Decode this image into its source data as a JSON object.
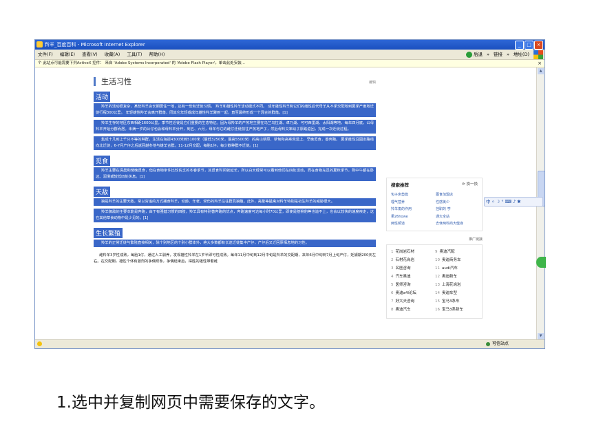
{
  "window": {
    "title": "羚羊_百度百科 - Microsoft Internet Explorer",
    "controls": [
      "_",
      "□",
      "×"
    ]
  },
  "menubar": {
    "items": [
      "文件(F)",
      "编辑(E)",
      "查看(V)",
      "收藏(A)",
      "工具(T)",
      "帮助(H)"
    ],
    "back": "后退",
    "arrows": "»",
    "link": "链接",
    "address": "地址(D)"
  },
  "infobar": {
    "text": "个 此站点可能需要下列ActiveX 控件： 来自 'Adobe Systems Incorporated' 的 'Adobe Flash Player'。单击此处安装...",
    "close": "×"
  },
  "article": {
    "section_title": "生活习性",
    "edit_label": "编辑",
    "activity": {
      "heading": "活动",
      "paragraphs": [
        "羚羊的活动很复杂，某些羚羊会长期居住一地，还有一些有迁徙习惯。 羚羊和雄性羚羊活动模式不同。 成年雄性羚羊和它们的雌性后代母羊从不季交配地到夏季产崽地迁徙行程300公里。 年轻雄性羚羊会离开群落，同其它年轻或成年雄性羚羊聚到一起，直至最终形成一个混合的群落。[1]",
        "羚羊生存的地区东西相距1600公里，季节性迁徙是它们重要的生态特征。因为母羚羊的产羔地主要在乌兰乌拉湖、卓乃湖、可可西里湖、太阳湖等地，每年四月底，公母羚羊开始分群而居。未满一岁的公仔也会和母羚羊分开，到五、六月，母羊与它的雌仔迁徙前往产羔地产子，然后母羚又率幼子原路返回，完成一次迁徙过程。",
        "集成十几到上千只不等的种群。生活在海拔4300米到5100米（最低3250米，最高5500米）的高山草原、草甸和高寒荒漠上，早晚觅食，善奔跑。 夏季雌性沿固定路线向北迁徙，6-7月产仔之后返回越冬地与雄羊合群。11-12月交配，每胎1仔。每少数种群不迁徙。[1]"
      ]
    },
    "food": {
      "heading": "觅食",
      "paragraphs": [
        "羚羊主要在清晨和傍晚觅食，但在食物条件比较贫乏的冬春季节，其觅食时间就延长，所以白天经常可以看到他们在四处活动，而在食物充足的夏秋季节，则中午都在卧边、润滑或较低凹处休息。[1]"
      ]
    },
    "enemy": {
      "heading": "天敌",
      "paragraphs": [
        "狼是羚羊的主要天敌，常以穷追的方式捕食羚羊，幼龄、年老、受伤的羚羊往往群具狼腹。此外，亮繁等猛禽对羚羊特别是初生羚羊的威胁很大。",
        "羚羊御敌的主要本能是奔跑，由于有强健习惯的四肢，羚羊具有特别善奔跑的优点，奔跑速度可达每小时70公里，即使是猞猁豹等也追不上，也会以较快的速度疾走，这在其他草食动物中是少见的。[1]"
      ]
    },
    "breed": {
      "heading": "生长繁殖",
      "paragraphs": [
        "羚羊的正常迁徙与繁殖直接相关，除个别地区的个别小群体外，绝大多数都有长途迁徙集中产仔，产仔后又迁回原栖息地的习性。"
      ],
      "plain": "雌羚羊3岁性成熟，每胎1仔，通过人工驯养，发现雄性羚羊在1岁半即可性成熟。每年11月中旬到12月中旬是羚羊的交配期，来年6月中旬到7月上旬产仔，妊娠期200天左右。在交配期，雄性个体有激烈的争偶现象，争偶结束后，得胜的雄性带着雌"
    }
  },
  "sidebar": {
    "search_title": "搜索推荐",
    "swap_label": "换一换",
    "links": [
      "包子床垫篇",
      "图食加盟店",
      "理气营养",
      "性感美少",
      "羚羊角的作用",
      "挂职的 亭",
      "果26howe",
      "通大全站",
      "两性频道",
      "去休两科商大健身"
    ],
    "ad_label": "推广链接",
    "rank": [
      {
        "n": "1",
        "t": "花岗岩石材"
      },
      {
        "n": "9",
        "t": "奥迪汽配"
      },
      {
        "n": "2",
        "t": "石材花岗岩"
      },
      {
        "n": "10",
        "t": "奥迪商务车"
      },
      {
        "n": "3",
        "t": "名医咨询"
      },
      {
        "n": "11",
        "t": "audi汽车"
      },
      {
        "n": "4",
        "t": "汽车奥迪"
      },
      {
        "n": "12",
        "t": "奥迪新车"
      },
      {
        "n": "5",
        "t": "医师咨询"
      },
      {
        "n": "13",
        "t": "上海花岗岩"
      },
      {
        "n": "6",
        "t": "奥迪a4l论坛"
      },
      {
        "n": "14",
        "t": "奥迪车型"
      },
      {
        "n": "7",
        "t": "好大夫咨询"
      },
      {
        "n": "15",
        "t": "宝马3系车"
      },
      {
        "n": "8",
        "t": "奥迪汽车"
      },
      {
        "n": "16",
        "t": "宝马3系新车"
      }
    ]
  },
  "ime": {
    "text": "中 ⸰ ☽ ° ⌨ ♪ ✱"
  },
  "statusbar": {
    "zone": "可信站点"
  },
  "caption": "1.选中并复制网页中需要保存的文字。",
  "colors": {
    "selection": "#3a67c8",
    "titlebar": "#2e67d6",
    "accent": "#4f79c7"
  }
}
